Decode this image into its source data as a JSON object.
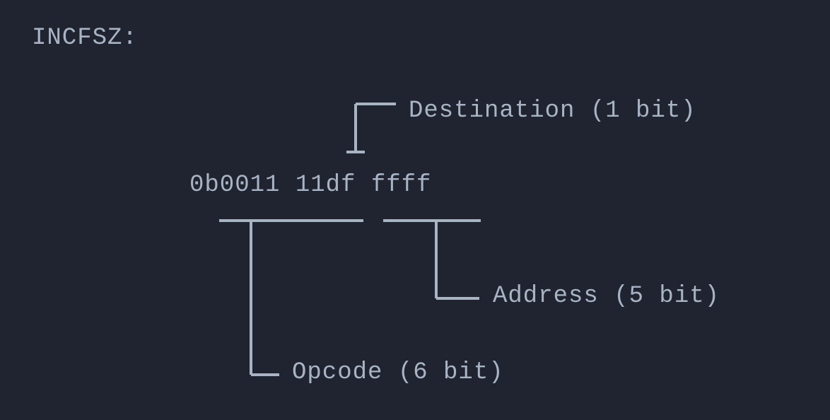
{
  "title": "INCFSZ:",
  "instruction_encoding": "0b0011 11df ffff",
  "annotations": {
    "destination": "Destination (1 bit)",
    "address": "Address (5 bit)",
    "opcode": "Opcode (6 bit)"
  }
}
